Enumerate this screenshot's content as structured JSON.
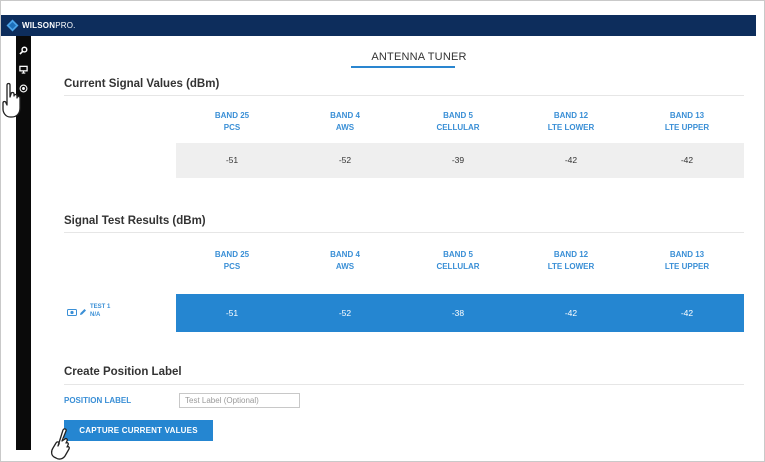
{
  "brand": {
    "name_bold": "WILSON",
    "name_light": "PRO."
  },
  "sidebar": {
    "icons": [
      "settings-icon",
      "monitor-icon",
      "target-icon"
    ]
  },
  "tab": {
    "label": "ANTENNA TUNER"
  },
  "current": {
    "heading": "Current Signal Values (dBm)",
    "bands": [
      {
        "line1": "BAND 25",
        "line2": "PCS"
      },
      {
        "line1": "BAND 4",
        "line2": "AWS"
      },
      {
        "line1": "BAND 5",
        "line2": "CELLULAR"
      },
      {
        "line1": "BAND 12",
        "line2": "LTE LOWER"
      },
      {
        "line1": "BAND 13",
        "line2": "LTE UPPER"
      }
    ],
    "values": [
      "-51",
      "-52",
      "-39",
      "-42",
      "-42"
    ]
  },
  "test": {
    "heading": "Signal Test Results (dBm)",
    "bands": [
      {
        "line1": "BAND 25",
        "line2": "PCS"
      },
      {
        "line1": "BAND 4",
        "line2": "AWS"
      },
      {
        "line1": "BAND 5",
        "line2": "CELLULAR"
      },
      {
        "line1": "BAND 12",
        "line2": "LTE LOWER"
      },
      {
        "line1": "BAND 13",
        "line2": "LTE UPPER"
      }
    ],
    "row": {
      "name": "TEST 1",
      "sub": "N/A",
      "values": [
        "-51",
        "-52",
        "-38",
        "-42",
        "-42"
      ]
    }
  },
  "position": {
    "heading": "Create Position Label",
    "label": "POSITION LABEL",
    "input_value": "",
    "input_placeholder": "Test Label (Optional)",
    "capture_label": "CAPTURE CURRENT VALUES"
  },
  "colors": {
    "topbar": "#0d2d5c",
    "accent": "#2586d1",
    "band_text": "#3a8fd6",
    "grey_row": "#efefef"
  }
}
